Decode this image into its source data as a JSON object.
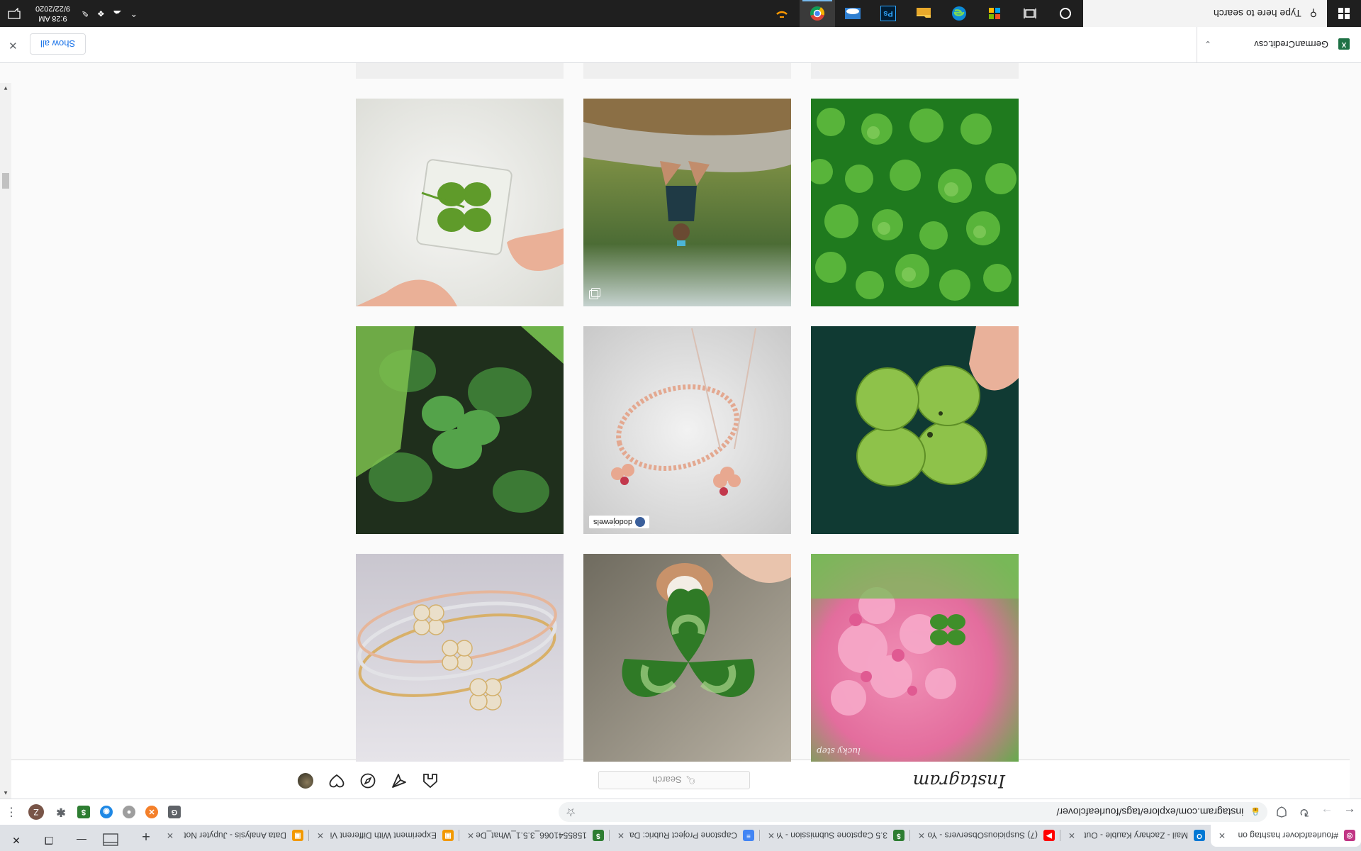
{
  "browser": {
    "tabs": [
      {
        "title": "#fourleafclover hashtag on",
        "favicon_color": "#c13584",
        "favicon_glyph": "◎",
        "active": true
      },
      {
        "title": "Mail - Zachary Kauble - Out",
        "favicon_color": "#0078d4",
        "favicon_glyph": "O",
        "active": false
      },
      {
        "title": "(7) SuspiciousObservers - Yo",
        "favicon_color": "#ff0000",
        "favicon_glyph": "▶",
        "active": false
      },
      {
        "title": "3.5 Capstone Submission - Yo",
        "favicon_color": "#2e7d32",
        "favicon_glyph": "$",
        "active": false
      },
      {
        "title": "Capstone Project Rubric: Da",
        "favicon_color": "#4285f4",
        "favicon_glyph": "≡",
        "active": false
      },
      {
        "title": "1585541066_3.5.1_What_De",
        "favicon_color": "#2e7d32",
        "favicon_glyph": "$",
        "active": false
      },
      {
        "title": "Experiment With Different Vi",
        "favicon_color": "#f29900",
        "favicon_glyph": "▣",
        "active": false
      },
      {
        "title": "Data Analysis - Jupyter Not",
        "favicon_color": "#f29900",
        "favicon_glyph": "▣",
        "active": false
      }
    ],
    "new_tab_glyph": "+",
    "address": {
      "url": "instagram.com/explore/tags/fourleafclover/"
    },
    "profile_initial": "Z"
  },
  "instagram": {
    "logo": "Instagram",
    "search_placeholder": "Search",
    "icons": [
      "home-icon",
      "direct-icon",
      "explore-icon",
      "activity-icon",
      "profile-avatar"
    ]
  },
  "posts": [
    {
      "subject": "four-leaf clover in pink flower bush",
      "signature": "lucky step",
      "multi": false
    },
    {
      "subject": "hand holding large four-leaf clover with dog",
      "multi": false
    },
    {
      "subject": "four-leaf clover diamond bracelets",
      "multi": false
    },
    {
      "subject": "hand holding four-leaf clover on dark fabric",
      "multi": false
    },
    {
      "subject": "four-leaf clover jewelry set",
      "watermark": "dodojewels",
      "multi": false
    },
    {
      "subject": "clover plants on soil",
      "multi": false
    },
    {
      "subject": "field of clover leaves",
      "multi": false
    },
    {
      "subject": "person sitting on rock in forest",
      "multi": true
    },
    {
      "subject": "four-leaf clover in glass cube",
      "multi": false
    }
  ],
  "downloads": {
    "file": "GermanCredit.csv",
    "show_all": "Show all"
  },
  "taskbar": {
    "search_placeholder": "Type here to search",
    "notification_count": "2",
    "time": "9:28 AM",
    "date": "9/22/2020"
  },
  "colors": {
    "taskbar_bg": "#1f1f1f",
    "accent": "#1a73e8",
    "ig_border": "#dbdbdb"
  }
}
